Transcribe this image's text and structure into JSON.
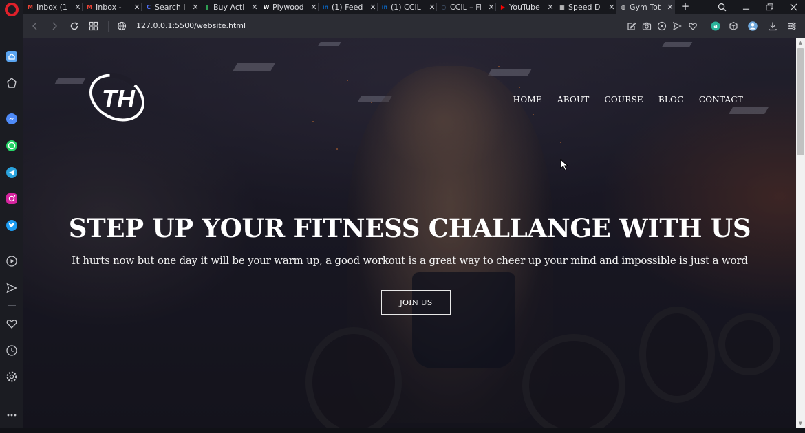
{
  "browser": {
    "tabs": [
      {
        "title": "Inbox (1",
        "favicon": "gmail-icon",
        "fav_glyph": "M",
        "fav_color": "#ea4335"
      },
      {
        "title": "Inbox - ",
        "favicon": "gmail-icon",
        "fav_glyph": "M",
        "fav_color": "#ea4335"
      },
      {
        "title": "Search I",
        "favicon": "search-engine-icon",
        "fav_glyph": "C",
        "fav_color": "#4f6ef7"
      },
      {
        "title": "Buy Acti",
        "favicon": "sheets-icon",
        "fav_glyph": "▮",
        "fav_color": "#2e9e52"
      },
      {
        "title": "Plywood",
        "favicon": "site-icon",
        "fav_glyph": "W",
        "fav_color": "#ffffff"
      },
      {
        "title": "(1) Feed",
        "favicon": "linkedin-icon",
        "fav_glyph": "in",
        "fav_color": "#0a66c2"
      },
      {
        "title": "(1) CCIL",
        "favicon": "linkedin-icon",
        "fav_glyph": "in",
        "fav_color": "#0a66c2"
      },
      {
        "title": "CCIL – Fi",
        "favicon": "loading-icon",
        "fav_glyph": "◌",
        "fav_color": "#7fa6d9"
      },
      {
        "title": "YouTube",
        "favicon": "youtube-icon",
        "fav_glyph": "▶",
        "fav_color": "#ff0000"
      },
      {
        "title": "Speed D",
        "favicon": "grid-icon",
        "fav_glyph": "▦",
        "fav_color": "#e6e6e6"
      },
      {
        "title": "Gym Tot",
        "favicon": "globe-icon",
        "fav_glyph": "◍",
        "fav_color": "#e6e6e6",
        "active": true
      }
    ],
    "url": "127.0.0.1:5500/website.html"
  },
  "site": {
    "logo_text": "TH",
    "nav": [
      "HOME",
      "ABOUT",
      "COURSE",
      "BLOG",
      "CONTACT"
    ],
    "hero_title": "STEP UP YOUR FITNESS CHALLANGE WITH US",
    "hero_subtitle": "It hurts now but one day it will be your warm up, a good workout is a great way to cheer up your mind and impossible is just a word",
    "cta_label": "JOIN US"
  },
  "colors": {
    "opera_red": "#e0202a",
    "active_tab": "#2c2d34",
    "toolbar_bg": "#2c2d34",
    "hero_text": "#ffffff"
  }
}
